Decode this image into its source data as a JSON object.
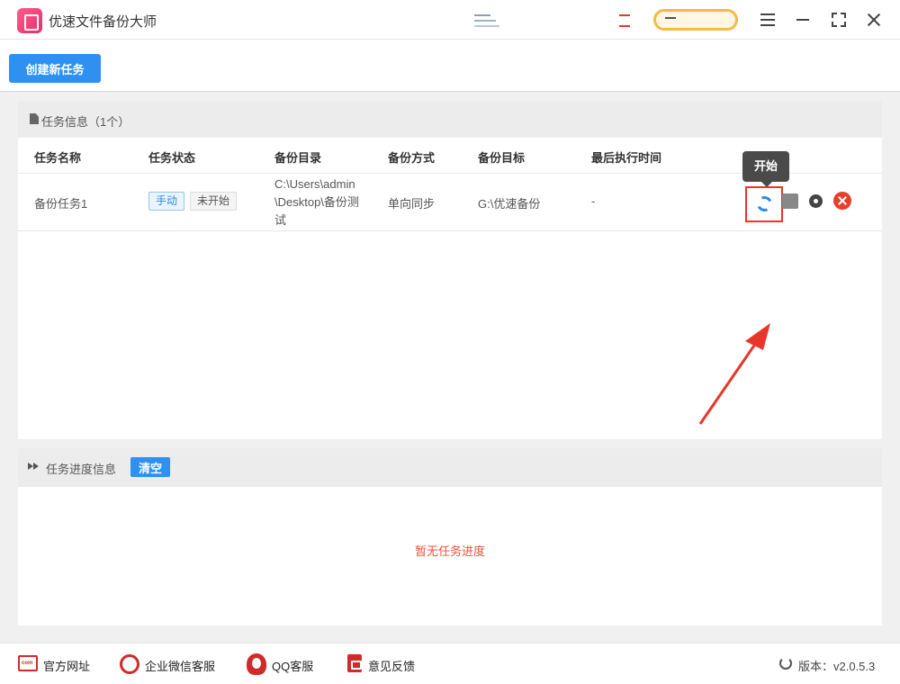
{
  "app": {
    "title": "优速文件备份大师"
  },
  "toolbar": {
    "create_label": "创建新任务"
  },
  "task_panel": {
    "title": "任务信息（1个）",
    "columns": [
      "任务名称",
      "任务状态",
      "备份目录",
      "备份方式",
      "备份目标",
      "最后执行时间"
    ],
    "rows": [
      {
        "name": "备份任务1",
        "mode_tag": "手动",
        "status_tag": "未开始",
        "source_dir": "C:\\Users\\admin\\Desktop\\备份测试",
        "method": "单向同步",
        "target": "G:\\优速备份",
        "last_run": "-"
      }
    ],
    "tooltip": "开始"
  },
  "progress_panel": {
    "title": "任务进度信息",
    "clear_label": "清空",
    "empty_text": "暂无任务进度"
  },
  "footer": {
    "website": "官方网址",
    "wechat": "企业微信客服",
    "qq": "QQ客服",
    "feedback": "意见反馈",
    "version": "版本：v2.0.5.3"
  },
  "colors": {
    "accent": "#2e90f0",
    "danger": "#e8362a",
    "highlight": "#f9b847"
  }
}
